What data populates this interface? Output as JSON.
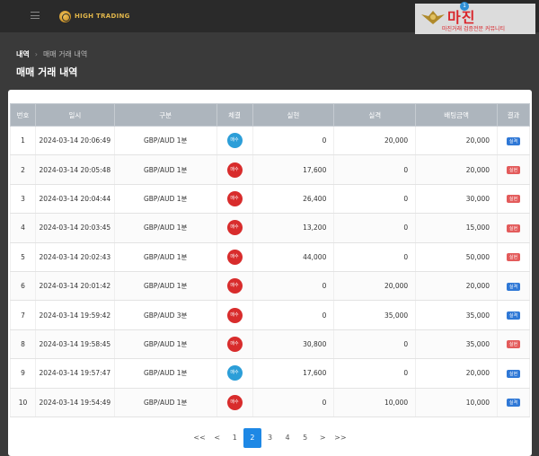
{
  "header": {
    "brand": "HIGH TRADING"
  },
  "watermark": {
    "title": "마진",
    "badge": "1",
    "subtitle": "마진거래 검증전문 커뮤니티"
  },
  "breadcrumb": {
    "root": "내역",
    "separator": "›",
    "current": "매매 거래 내역"
  },
  "page_title": "매매 거래 내역",
  "table": {
    "headers": [
      "번호",
      "일시",
      "구분",
      "체결",
      "실현",
      "실격",
      "배팅금액",
      "결과"
    ],
    "rows": [
      {
        "no": "1",
        "datetime": "2024-03-14 20:06:49",
        "category": "GBP/AUD 1분",
        "side": "매수",
        "side_type": "buy",
        "realized": "0",
        "loss": "20,000",
        "bet": "20,000",
        "result": "실격",
        "result_type": "win"
      },
      {
        "no": "2",
        "datetime": "2024-03-14 20:05:48",
        "category": "GBP/AUD 1분",
        "side": "매수",
        "side_type": "sell",
        "realized": "17,600",
        "loss": "0",
        "bet": "20,000",
        "result": "실현",
        "result_type": "lose"
      },
      {
        "no": "3",
        "datetime": "2024-03-14 20:04:44",
        "category": "GBP/AUD 1분",
        "side": "매수",
        "side_type": "sell",
        "realized": "26,400",
        "loss": "0",
        "bet": "30,000",
        "result": "실현",
        "result_type": "lose"
      },
      {
        "no": "4",
        "datetime": "2024-03-14 20:03:45",
        "category": "GBP/AUD 1분",
        "side": "매수",
        "side_type": "sell",
        "realized": "13,200",
        "loss": "0",
        "bet": "15,000",
        "result": "실현",
        "result_type": "lose"
      },
      {
        "no": "5",
        "datetime": "2024-03-14 20:02:43",
        "category": "GBP/AUD 1분",
        "side": "매수",
        "side_type": "sell",
        "realized": "44,000",
        "loss": "0",
        "bet": "50,000",
        "result": "실현",
        "result_type": "lose"
      },
      {
        "no": "6",
        "datetime": "2024-03-14 20:01:42",
        "category": "GBP/AUD 1분",
        "side": "매수",
        "side_type": "sell",
        "realized": "0",
        "loss": "20,000",
        "bet": "20,000",
        "result": "실격",
        "result_type": "win"
      },
      {
        "no": "7",
        "datetime": "2024-03-14 19:59:42",
        "category": "GBP/AUD 3분",
        "side": "매수",
        "side_type": "sell",
        "realized": "0",
        "loss": "35,000",
        "bet": "35,000",
        "result": "실격",
        "result_type": "win"
      },
      {
        "no": "8",
        "datetime": "2024-03-14 19:58:45",
        "category": "GBP/AUD 1분",
        "side": "매수",
        "side_type": "sell",
        "realized": "30,800",
        "loss": "0",
        "bet": "35,000",
        "result": "실현",
        "result_type": "lose"
      },
      {
        "no": "9",
        "datetime": "2024-03-14 19:57:47",
        "category": "GBP/AUD 1분",
        "side": "매수",
        "side_type": "buy",
        "realized": "17,600",
        "loss": "0",
        "bet": "20,000",
        "result": "실현",
        "result_type": "win"
      },
      {
        "no": "10",
        "datetime": "2024-03-14 19:54:49",
        "category": "GBP/AUD 1분",
        "side": "매수",
        "side_type": "sell",
        "realized": "0",
        "loss": "10,000",
        "bet": "10,000",
        "result": "실격",
        "result_type": "win"
      }
    ]
  },
  "pagination": {
    "first": "<<",
    "prev": "<",
    "pages": [
      "1",
      "2",
      "3",
      "4",
      "5"
    ],
    "active": "2",
    "next": ">",
    "last": ">>"
  },
  "colors": {
    "accent": "#1e88e5",
    "buy": "#2c9ed8",
    "sell": "#d82c2c",
    "win_tag": "#2f78d6",
    "lose_tag": "#e35b5b"
  }
}
